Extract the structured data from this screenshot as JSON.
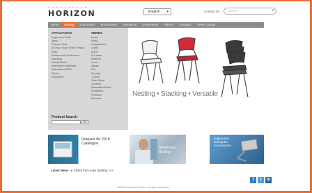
{
  "header": {
    "logo_text": "HORIZON",
    "language": "English",
    "contact_label": "Contact Us",
    "search_placeholder": "Search"
  },
  "nav": {
    "tabs": [
      "Home",
      "Seating",
      "Ergonomics",
      "Environment",
      "Resources",
      "Government",
      "Fabrics",
      "Company",
      "Green Lounge"
    ],
    "active": "Seating"
  },
  "menu": {
    "application_heading": "APPLICATION",
    "application_items": [
      "Ergonomic Task",
      "Mesh",
      "Planner Seat",
      "24 Hour Stool Shift / Heavy Duty",
      "Boardroom/Conference",
      "Stacking",
      "Guest/Visitor",
      "Industrial Healthcare",
      "Specialized ESD",
      "Stools",
      "Reception"
    ],
    "series_heading": "SERIES",
    "series_items": [
      "Crave",
      "Rhea",
      "CuppaMesh",
      "Claris",
      "Achit",
      "E-Comm",
      "Rubicon",
      "Coco",
      "Aspen",
      "Era",
      "Fenada",
      "T-Zone",
      "Steel Stool",
      "Cuvelity",
      "Stackable/Guest",
      "Shopdeck",
      "Premium",
      "Element"
    ],
    "product_search_label": "Product Search",
    "go_label": "Go"
  },
  "hero": {
    "tagline": "Nesting • Stacking • Versatile"
  },
  "promos": {
    "catalogue": "Request for 2018 Catalogue",
    "healthcare": "Healthcare Seating",
    "ergonomic": "Ergonomic Computer Accessories"
  },
  "news": {
    "label": "Latest News",
    "text": "▸ Chairs from Activ Seating >>>"
  },
  "social": {
    "facebook": "f",
    "twitter": "t",
    "linkedin": "in"
  },
  "footer": {
    "copyright": "©2018 Horizon Furniture. All rights reserved."
  },
  "colors": {
    "accent": "#e86f35",
    "nav_bg": "#8a8a8a",
    "menu_bg": "#d7d7d7",
    "chair_red": "#d6293a",
    "social_blue": "#3b7dc6"
  }
}
